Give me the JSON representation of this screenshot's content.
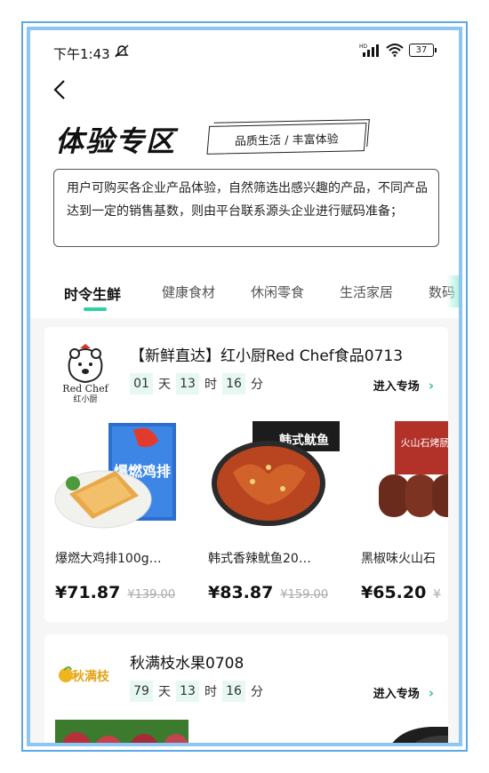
{
  "status_bar": {
    "time": "下午1:43",
    "network": "HD",
    "battery": "37"
  },
  "header": {
    "title": "体验专区",
    "tag": "品质生活 / 丰富体验",
    "description": "用户可购买各企业产品体验，自然筛选出感兴趣的产品，不同产品达到一定的销售基数，则由平台联系源头企业进行赋码准备；"
  },
  "tabs": [
    {
      "label": "时令生鲜",
      "active": true
    },
    {
      "label": "健康食材",
      "active": false
    },
    {
      "label": "休闲零食",
      "active": false
    },
    {
      "label": "生活家居",
      "active": false
    },
    {
      "label": "数码",
      "active": false
    }
  ],
  "stores": [
    {
      "name": "【新鲜直达】红小厨Red Chef食品0713",
      "logo_text_en": "Red Chef",
      "logo_text_cn": "红小厨",
      "countdown": {
        "days": "01",
        "day_unit": "天",
        "hours": "13",
        "hour_unit": "时",
        "minutes": "16",
        "minute_unit": "分"
      },
      "enter_label": "进入专场",
      "products": [
        {
          "name": "爆燃大鸡排100g…",
          "price": "¥71.87",
          "old_price": "¥139.00",
          "pack_text": "爆燃鸡排"
        },
        {
          "name": "韩式香辣鱿鱼20…",
          "price": "¥83.87",
          "old_price": "¥159.00",
          "pack_text": "韩式鱿鱼"
        },
        {
          "name": "黑椒味火山石",
          "price": "¥65.20",
          "old_price": "¥",
          "pack_text": "火山石烤肠"
        }
      ]
    },
    {
      "name": "秋满枝水果0708",
      "logo_text_cn": "秋满枝",
      "countdown": {
        "days": "79",
        "day_unit": "天",
        "hours": "13",
        "hour_unit": "时",
        "minutes": "16",
        "minute_unit": "分"
      },
      "enter_label": "进入专场"
    }
  ],
  "colors": {
    "accent": "#2fd0a8",
    "countdown_bg": "#e6f8f1",
    "frame": "#8cc6f2"
  },
  "icons": [
    "back-arrow-icon",
    "mute-icon",
    "signal-icon",
    "wifi-icon",
    "battery-icon",
    "chevron-right-icon"
  ]
}
